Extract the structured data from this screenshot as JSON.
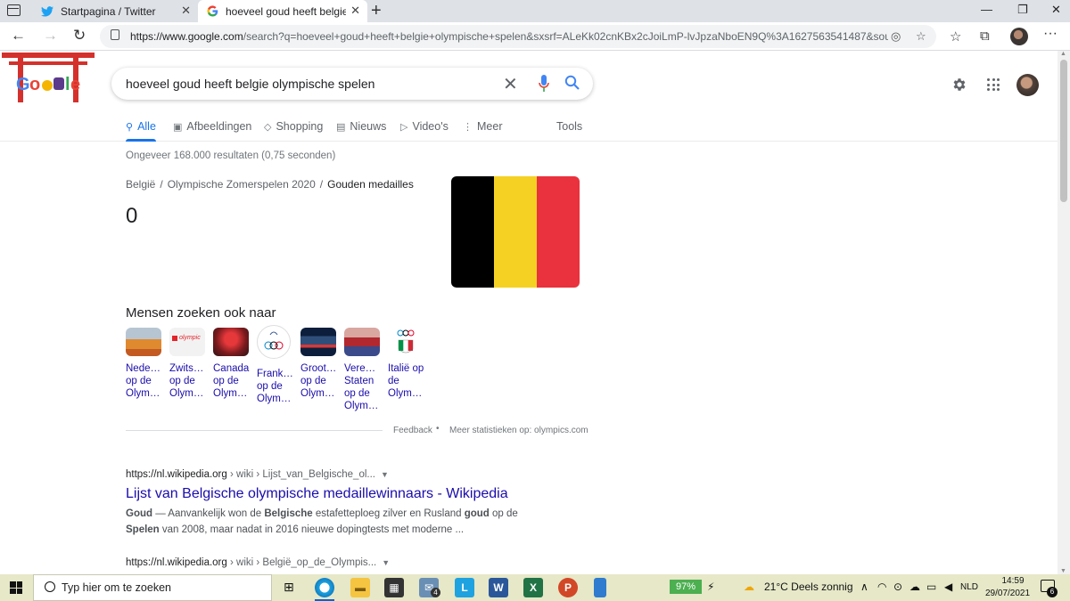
{
  "browser": {
    "tabs": [
      {
        "title": "Startpagina / Twitter",
        "icon": "twitter-icon"
      },
      {
        "title": "hoeveel goud heeft belgie olympische spelen",
        "icon": "google-icon"
      }
    ],
    "url": {
      "host": "https://www.google.com",
      "path": "/search?q=hoeveel+goud+heeft+belgie+olympische+spelen&sxsrf=ALeKk02cnKBx2cJoiLmP-lvJpzaNboEN9Q%3A1627563541487&source=hp&ei..."
    }
  },
  "google": {
    "search_query": "hoeveel goud heeft belgie olympische spelen",
    "tabs": [
      "Alle",
      "Afbeeldingen",
      "Shopping",
      "Nieuws",
      "Video's",
      "Meer",
      "Tools"
    ],
    "result_stats": "Ongeveer 168.000 resultaten (0,75 seconden)",
    "answer": {
      "breadcrumb": [
        "België",
        "Olympische Zomerspelen 2020",
        "Gouden medailles"
      ],
      "value": "0",
      "flag_colors": [
        "#000000",
        "#f5d123",
        "#e9323d"
      ]
    },
    "people_also_search": {
      "title": "Mensen zoeken ook naar",
      "items": [
        {
          "label": "Nede…\nop de\nOlym…"
        },
        {
          "label": "Zwits…\nop de\nOlym…"
        },
        {
          "label": "Canada\nop de\nOlym…"
        },
        {
          "label": "Frank…\nop de\nOlym…"
        },
        {
          "label": "Groot…\nop de\nOlym…"
        },
        {
          "label": "Vere…\nStaten\nop de\nOlym…"
        },
        {
          "label": "Italië op\nde\nOlym…"
        }
      ]
    },
    "feedback": "Feedback",
    "stats_link": "Meer statistieken op: olympics.com",
    "results": [
      {
        "host": "https://nl.wikipedia.org",
        "crumbs": " › wiki › Lijst_van_Belgische_ol...",
        "title": "Lijst van Belgische olympische medaillewinnaars - Wikipedia",
        "snippet_html": "<b>Goud</b> — Aanvankelijk won de <b>Belgische</b> estafetteploeg zilver en Rusland <b>goud</b> op de <b>Spelen</b> van 2008, maar nadat in 2016 nieuwe dopingtests met moderne ..."
      },
      {
        "host": "https://nl.wikipedia.org",
        "crumbs": " › wiki › België_op_de_Olympis...",
        "title": "",
        "snippet_html": ""
      }
    ]
  },
  "taskbar": {
    "search_placeholder": "Typ hier om te zoeken",
    "mail_badge": "4",
    "battery": "97%",
    "weather": "21°C  Deels zonnig",
    "language": "NLD",
    "time": "14:59",
    "date": "29/07/2021",
    "notification_count": "6"
  },
  "colors": {
    "google_link": "#1a0dab",
    "google_blue": "#1a73e8",
    "taskbar_bg": "#e6e8c8"
  }
}
